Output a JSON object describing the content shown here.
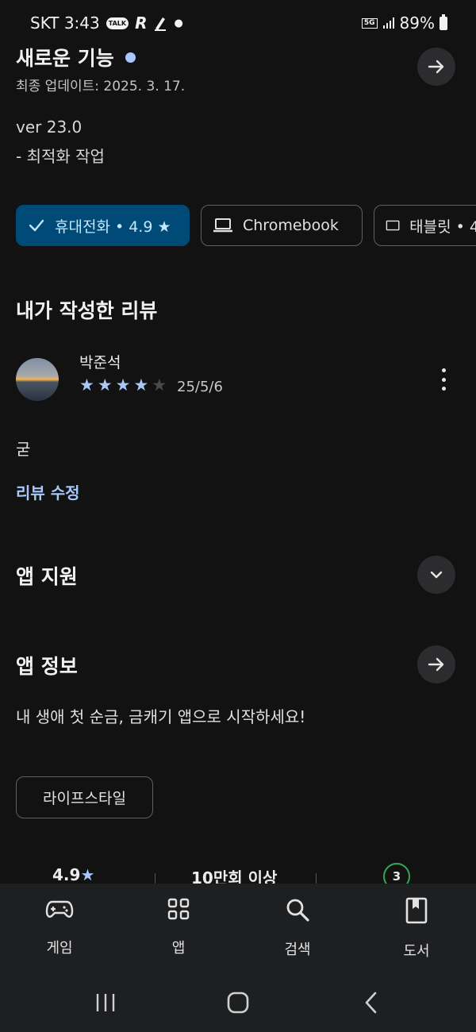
{
  "status_bar": {
    "carrier_time": "SKT 3:43",
    "talk_badge": "TALK",
    "glyph": "R",
    "network": "5G",
    "battery": "89%"
  },
  "whats_new": {
    "title": "새로운 기능",
    "updated": "최종 업데이트: 2025. 3. 17.",
    "version": "ver 23.0",
    "notes": "- 최적화 작업"
  },
  "device_chips": [
    {
      "label": "휴대전화 • 4.9 ★",
      "icon": "check-icon",
      "selected": true
    },
    {
      "label": "Chromebook",
      "icon": "laptop-icon",
      "selected": false
    },
    {
      "label": "태블릿 • 4",
      "icon": "tablet-icon",
      "selected": false
    }
  ],
  "my_review": {
    "section_title": "내가 작성한 리뷰",
    "reviewer": "박준석",
    "rating": 4,
    "max_rating": 5,
    "date": "25/5/6",
    "text": "굳",
    "edit_label": "리뷰 수정"
  },
  "app_support": {
    "title": "앱 지원"
  },
  "app_info": {
    "title": "앱 정보",
    "description": "내 생애 첫 순금, 금캐기 앱으로 시작하세요!",
    "category": "라이프스타일"
  },
  "stats": {
    "rating": "4.9",
    "rating_star": "★",
    "downloads": "10만회 이상",
    "age_rating": "3"
  },
  "bottom_nav": [
    {
      "label": "게임",
      "icon": "gamepad-icon"
    },
    {
      "label": "앱",
      "icon": "apps-grid-icon"
    },
    {
      "label": "검색",
      "icon": "search-icon"
    },
    {
      "label": "도서",
      "icon": "book-icon"
    }
  ],
  "colors": {
    "background": "#121212",
    "accent": "#a8c7fa",
    "selected_chip": "#004a77",
    "nav_background": "#1e1f21",
    "age_badge": "#34a853"
  }
}
